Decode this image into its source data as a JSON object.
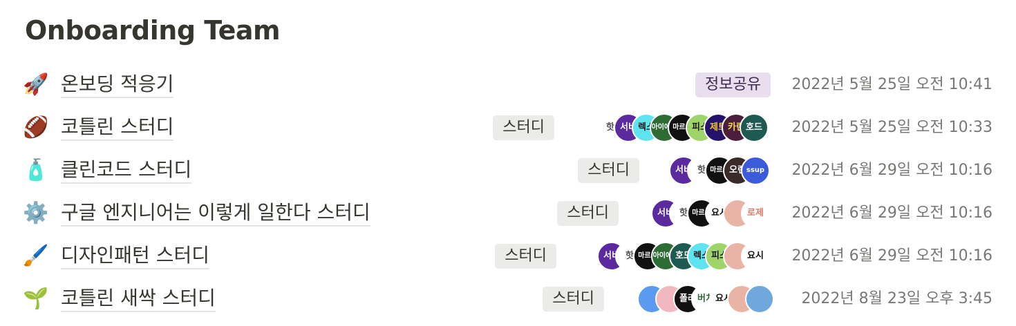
{
  "page": {
    "title": "Onboarding Team"
  },
  "rows": [
    {
      "icon": "🚀",
      "icon_name": "rocket-icon",
      "title": "온보딩 적응기",
      "tag": "정보공유",
      "avatars": [],
      "date": "2022년 5월 25일 오전 10:41"
    },
    {
      "icon": "🏈",
      "icon_name": "football-icon",
      "title": "코틀린 스터디",
      "tag": "스터디",
      "avatars": [
        {
          "text": "핫",
          "bg": "#ffffff",
          "fg": "#555555"
        },
        {
          "text": "서비",
          "bg": "#5b2a9e",
          "fg": "#ffffff"
        },
        {
          "text": "렉스",
          "bg": "#5fe3f0",
          "fg": "#1a1a1a"
        },
        {
          "text": "아이에나",
          "bg": "#2e6b35",
          "fg": "#ffffff"
        },
        {
          "text": "마르코",
          "bg": "#111111",
          "fg": "#ffffff"
        },
        {
          "text": "피스",
          "bg": "#9fd46a",
          "fg": "#1a1a1a"
        },
        {
          "text": "제토",
          "bg": "#25126b",
          "fg": "#f4c430"
        },
        {
          "text": "카린",
          "bg": "#4a1f3d",
          "fg": "#ffd84a"
        },
        {
          "text": "호드",
          "bg": "#1f5a52",
          "fg": "#ffffff"
        }
      ],
      "date": "2022년 5월 25일 오전 10:33"
    },
    {
      "icon": "🧴",
      "icon_name": "lotion-bottle-icon",
      "title": "클린코드 스터디",
      "tag": "스터디",
      "avatars": [
        {
          "text": "서비",
          "bg": "#5b2a9e",
          "fg": "#ffffff"
        },
        {
          "text": "핫",
          "bg": "#ffffff",
          "fg": "#555555"
        },
        {
          "text": "마르코",
          "bg": "#111111",
          "fg": "#ffffff"
        },
        {
          "text": "오랜",
          "bg": "#3a2a2a",
          "fg": "#ffffff"
        },
        {
          "text": "ssup",
          "bg": "#3b5bdb",
          "fg": "#ffffff"
        }
      ],
      "date": "2022년 6월 29일 오전 10:16"
    },
    {
      "icon": "⚙️",
      "icon_name": "gear-icon",
      "title": "구글 엔지니어는 이렇게 일한다 스터디",
      "tag": "스터디",
      "avatars": [
        {
          "text": "서비",
          "bg": "#5b2a9e",
          "fg": "#ffffff"
        },
        {
          "text": "핫",
          "bg": "#ffffff",
          "fg": "#555555"
        },
        {
          "text": "마르코",
          "bg": "#111111",
          "fg": "#ffffff"
        },
        {
          "text": "요시",
          "bg": "#ffffff",
          "fg": "#111111"
        },
        {
          "text": "",
          "bg": "#e8b4a6",
          "fg": "#111111"
        },
        {
          "text": "로제",
          "bg": "#ffffff",
          "fg": "#e07a6a"
        }
      ],
      "date": "2022년 6월 29일 오전 10:16"
    },
    {
      "icon": "🖌️",
      "icon_name": "paintbrush-icon",
      "title": "디자인패턴 스터디",
      "tag": "스터디",
      "avatars": [
        {
          "text": "서비",
          "bg": "#5b2a9e",
          "fg": "#ffffff"
        },
        {
          "text": "핫",
          "bg": "#ffffff",
          "fg": "#555555"
        },
        {
          "text": "마르코",
          "bg": "#111111",
          "fg": "#ffffff"
        },
        {
          "text": "아이에나",
          "bg": "#2e6b35",
          "fg": "#ffffff"
        },
        {
          "text": "호드",
          "bg": "#1f5a52",
          "fg": "#ffffff"
        },
        {
          "text": "렉스",
          "bg": "#5fe3f0",
          "fg": "#1a1a1a"
        },
        {
          "text": "피스",
          "bg": "#9fd46a",
          "fg": "#1a1a1a"
        },
        {
          "text": "",
          "bg": "#e8b4a6",
          "fg": "#111111"
        },
        {
          "text": "요시",
          "bg": "#ffffff",
          "fg": "#111111"
        }
      ],
      "date": "2022년 6월 29일 오전 10:16"
    },
    {
      "icon": "🌱",
      "icon_name": "seedling-icon",
      "title": "코틀린 새싹 스터디",
      "tag": "스터디",
      "avatars": [
        {
          "text": "",
          "bg": "#5b9bef",
          "fg": "#ffffff"
        },
        {
          "text": "",
          "bg": "#f2b8c0",
          "fg": "#2e7d32"
        },
        {
          "text": "폴라",
          "bg": "#111111",
          "fg": "#ffffff"
        },
        {
          "text": "버치",
          "bg": "#ffffff",
          "fg": "#2e6b35"
        },
        {
          "text": "요시",
          "bg": "#ffffff",
          "fg": "#111111"
        },
        {
          "text": "",
          "bg": "#e8b4a6",
          "fg": "#111111"
        },
        {
          "text": "",
          "bg": "#6fa8dc",
          "fg": "#ffffff"
        }
      ],
      "date": "2022년 8월 23일 오후 3:45"
    }
  ]
}
